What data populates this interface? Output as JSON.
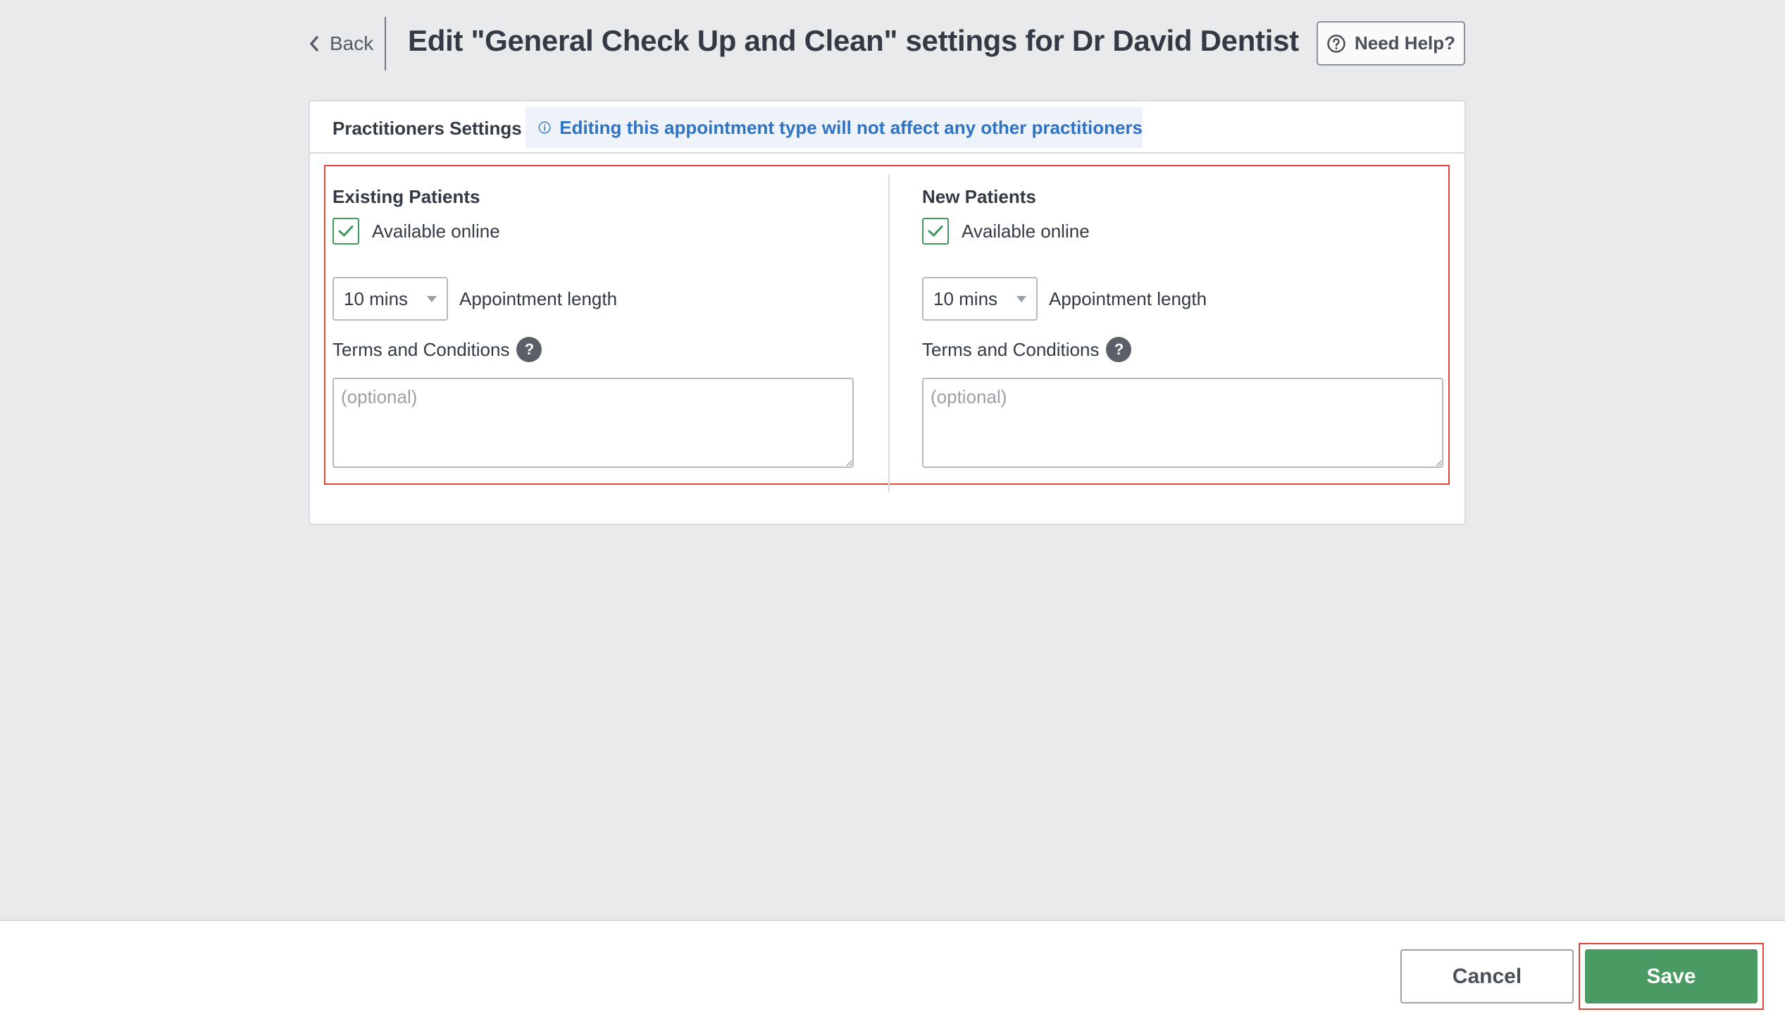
{
  "header": {
    "back_label": "Back",
    "title": "Edit \"General Check Up and Clean\" settings for Dr David Dentist",
    "help_label": "Need Help?"
  },
  "card": {
    "tab_label": "Practitioners Settings",
    "info_text": "Editing this appointment type will not affect any other practitioners"
  },
  "existing": {
    "title": "Existing Patients",
    "available_label": "Available online",
    "available_checked": true,
    "length_value": "10 mins",
    "length_label": "Appointment length",
    "terms_label": "Terms and Conditions",
    "terms_help": "?",
    "terms_placeholder": "(optional)",
    "terms_value": ""
  },
  "new": {
    "title": "New Patients",
    "available_label": "Available online",
    "available_checked": true,
    "length_value": "10 mins",
    "length_label": "Appointment length",
    "terms_label": "Terms and Conditions",
    "terms_help": "?",
    "terms_placeholder": "(optional)",
    "terms_value": ""
  },
  "footer": {
    "cancel_label": "Cancel",
    "save_label": "Save"
  },
  "colors": {
    "accent_green": "#4a9a63",
    "info_blue": "#2f73c4",
    "highlight_red": "#e0453a"
  },
  "icons": {
    "back": "chevron-left-icon",
    "help": "question-circle-icon",
    "info": "info-circle-icon",
    "check": "checkmark-icon",
    "dropdown": "caret-down-icon"
  }
}
